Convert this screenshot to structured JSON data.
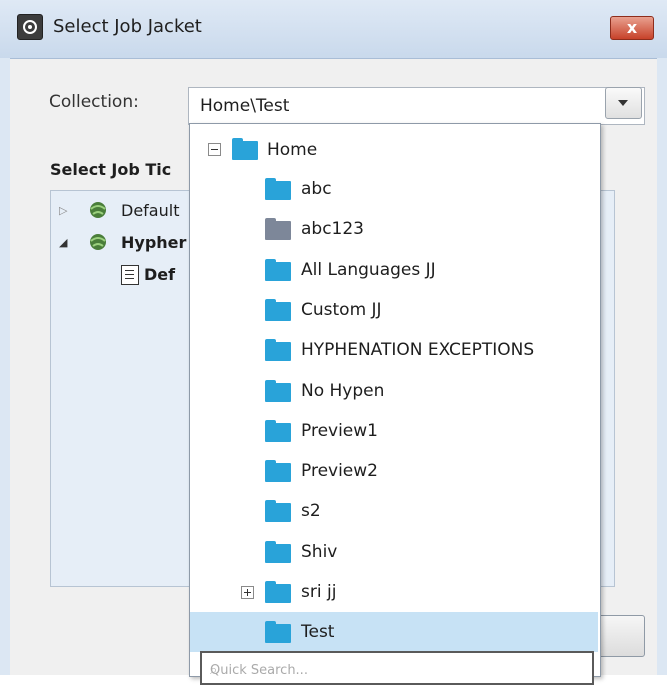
{
  "window": {
    "title": "Select Job Jacket",
    "close_glyph": "x",
    "app_icon": "job-jacket-icon"
  },
  "collection": {
    "label": "Collection:",
    "value": "Home\\Test"
  },
  "tickets": {
    "label": "Select Job Tic",
    "items": [
      {
        "label": "Default",
        "expanded": false
      },
      {
        "label": "Hypher",
        "expanded": true
      },
      {
        "label": "Def",
        "type": "document"
      }
    ]
  },
  "dropdown": {
    "root": {
      "label": "Home",
      "expanded": true
    },
    "folders": [
      {
        "label": "abc",
        "color": "#29a3d9",
        "has_children": false
      },
      {
        "label": "abc123",
        "color": "#7d8799",
        "has_children": false
      },
      {
        "label": "All Languages JJ",
        "color": "#29a3d9",
        "has_children": false
      },
      {
        "label": "Custom JJ",
        "color": "#29a3d9",
        "has_children": false
      },
      {
        "label": "HYPHENATION EXCEPTIONS",
        "color": "#29a3d9",
        "has_children": false
      },
      {
        "label": "No Hypen",
        "color": "#29a3d9",
        "has_children": false
      },
      {
        "label": "Preview1",
        "color": "#29a3d9",
        "has_children": false
      },
      {
        "label": "Preview2",
        "color": "#29a3d9",
        "has_children": false
      },
      {
        "label": "s2",
        "color": "#29a3d9",
        "has_children": false
      },
      {
        "label": "Shiv",
        "color": "#29a3d9",
        "has_children": false
      },
      {
        "label": "sri jj",
        "color": "#29a3d9",
        "has_children": true
      },
      {
        "label": "Test",
        "color": "#29a3d9",
        "has_children": false,
        "selected": true
      }
    ],
    "quick_search_placeholder": "Quick Search..."
  },
  "colors": {
    "folder_blue": "#29a3d9",
    "folder_gray": "#7d8799",
    "selection": "#c7e2f5",
    "close_red": "#c7422a"
  }
}
